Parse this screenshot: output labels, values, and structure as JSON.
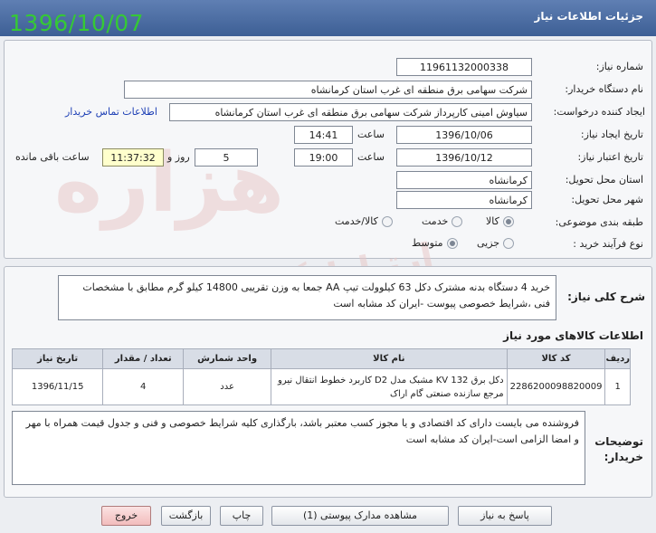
{
  "header": {
    "title": "جزئیات اطلاعات نیاز",
    "date_stamp": "1396/10/07"
  },
  "form": {
    "need_number": {
      "label": "شماره نیاز:",
      "value": "11961132000338"
    },
    "buyer_org": {
      "label": "نام دستگاه خریدار:",
      "value": "شرکت سهامی برق منطقه ای غرب استان کرمانشاه"
    },
    "requester": {
      "label": "ایجاد کننده درخواست:",
      "value": "سیاوش  امینی کارپرداز شرکت سهامی برق منطقه ای غرب استان کرمانشاه",
      "contact_link": "اطلاعات تماس خریدار"
    },
    "created": {
      "label": "تاریخ ایجاد نیاز:",
      "date": "1396/10/06",
      "time_label": "ساعت",
      "time": "14:41"
    },
    "validity": {
      "label": "تاریخ اعتبار نیاز:",
      "date": "1396/10/12",
      "time_label": "ساعت",
      "time": "19:00",
      "days": "5",
      "days_label": "روز و",
      "remaining": "11:37:32",
      "remaining_label": "ساعت باقی مانده"
    },
    "province": {
      "label": "استان محل تحویل:",
      "value": "کرمانشاه"
    },
    "city": {
      "label": "شهر محل تحویل:",
      "value": "کرمانشاه"
    },
    "category": {
      "label": "طبقه بندی موضوعی:",
      "options": [
        "کالا",
        "خدمت",
        "کالا/خدمت"
      ],
      "selected": "کالا"
    },
    "process": {
      "label": "نوع فرآیند خرید :",
      "options": [
        "جزیی",
        "متوسط"
      ],
      "selected": "متوسط"
    }
  },
  "summary": {
    "label": "شرح کلی نیاز:",
    "text": "خرید 4 دستگاه بدنه مشترک دکل 63 کیلوولت تیپ AA جمعا به وزن تقریبی 14800 کیلو گرم مطابق با مشخصات فنی ،شرایط خصوصی پیوست -ایران کد مشابه است"
  },
  "goods": {
    "title": "اطلاعات کالاهای مورد نیاز",
    "columns": [
      "ردیف",
      "کد کالا",
      "نام کالا",
      "واحد شمارش",
      "تعداد / مقدار",
      "تاریخ نیاز"
    ],
    "rows": [
      {
        "row": "1",
        "code": "2286200098820009",
        "name": "دکل برق 132 KV مشبک مدل D2 کاربرد خطوط انتقال نیرو مرجع سازنده صنعتی گام اراک",
        "unit": "عدد",
        "qty": "4",
        "date": "1396/11/15"
      }
    ]
  },
  "notes": {
    "label": "توضیحات خریدار:",
    "text": "فروشنده می بایست دارای کد اقتصادی و یا مجوز کسب معتبر باشد، بارگذاری کلیه شرایط خصوصی و فنی و جدول قیمت همراه با مهر و امضا الزامی است-ایران کد مشابه است"
  },
  "buttons": {
    "reply": "پاسخ به نیاز",
    "attachments": "مشاهده مدارک پیوستی (1)",
    "print": "چاپ",
    "back": "بازگشت",
    "exit": "خروج"
  },
  "watermark": {
    "main": "هزاره",
    "sub": "ارتباط گستران"
  },
  "colors": {
    "header": "#4a6aa3",
    "date_stamp": "#35c935",
    "link": "#1d3fb5",
    "remaining_bg": "#ffffcc",
    "exit_button": "#f2bcbc"
  }
}
